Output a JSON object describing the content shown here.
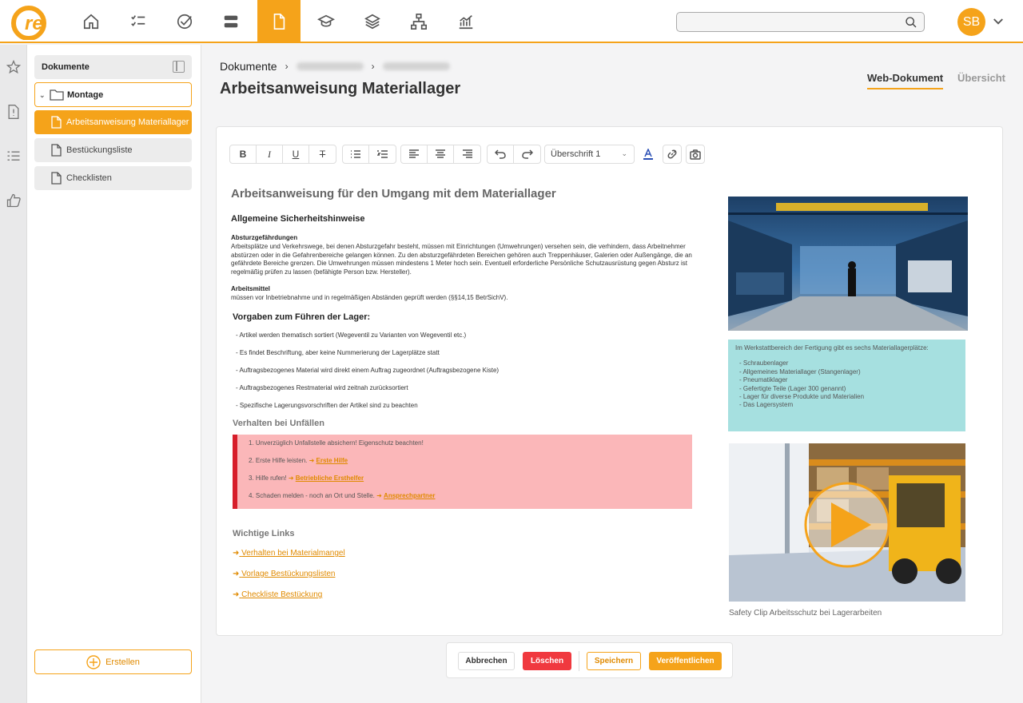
{
  "topbar": {
    "avatar_initials": "SB",
    "nav_icons": [
      "home-icon",
      "checklist-icon",
      "check-circle-icon",
      "stack-icon",
      "document-icon",
      "graduation-icon",
      "layers-icon",
      "hierarchy-icon",
      "chart-icon"
    ],
    "search_placeholder": ""
  },
  "rail": {
    "icons": [
      "star-icon",
      "warning-document-icon",
      "list-icon",
      "thumbs-up-icon"
    ]
  },
  "sidebar": {
    "header": "Dokumente",
    "folder": "Montage",
    "items": [
      {
        "label": "Arbeitsanweisung Materiallager",
        "active": true
      },
      {
        "label": "Bestückungsliste",
        "active": false
      },
      {
        "label": "Checklisten",
        "active": false
      }
    ],
    "create_label": "Erstellen"
  },
  "breadcrumb": {
    "root": "Dokumente"
  },
  "page": {
    "title": "Arbeitsanweisung Materiallager",
    "tabs": [
      {
        "label": "Web-Dokument",
        "active": true
      },
      {
        "label": "Übersicht",
        "active": false
      }
    ]
  },
  "toolbar": {
    "bold": "B",
    "italic": "I",
    "underline": "U",
    "strike": "T",
    "heading_select": "Überschrift 1"
  },
  "document": {
    "title": "Arbeitsanweisung für den Umgang mit dem Materiallager",
    "section1": "Allgemeine Sicherheitshinweise",
    "sub1_title": "Absturzgefährdungen",
    "sub1_text": "Arbeitsplätze und Verkehrswege, bei denen Absturzgefahr besteht, müssen mit Einrichtungen (Umwehrungen) versehen sein, die verhindern, dass Arbeitnehmer abstürzen oder in die Gefahrenbereiche gelangen können. Zu den absturzgefährdeten Bereichen gehören auch Treppenhäuser, Galerien oder Außengänge, die an gefährdete Bereiche grenzen. Die Umwehrungen müssen mindestens 1 Meter hoch sein. Eventuell erforderliche Persönliche Schutzausrüstung gegen Absturz ist regelmäßig prüfen zu lassen (befähigte Person bzw. Hersteller).",
    "sub2_title": "Arbeitsmittel",
    "sub2_text": "müssen vor Inbetriebnahme und in regelmäßigen Abständen geprüft werden (§§14,15 BetrSichV).",
    "section2": "Vorgaben zum Führen der Lager:",
    "vorgaben": [
      "- Artikel werden thematisch sortiert (Wegeventil zu Varianten von Wegeventil etc.)",
      "- Es findet Beschriftung, aber keine Nummerierung der Lagerplätze statt",
      "- Auftragsbezogenes Material wird direkt einem Auftrag zugeordnet (Auftragsbezogene Kiste)",
      "- Auftragsbezogenes Restmaterial wird zeitnah zurücksortiert",
      "- Spezifische Lagerungsvorschriften der Artikel sind zu beachten"
    ],
    "section3": "Verhalten bei Unfällen",
    "unfall_steps": [
      {
        "text": "1. Unverzüglich Unfallstelle absichern! Eigenschutz beachten!",
        "link": ""
      },
      {
        "text": "2. Erste Hilfe leisten. ",
        "link": "Erste Hilfe"
      },
      {
        "text": "3. Hilfe rufen! ",
        "link": "Betriebliche Ersthelfer"
      },
      {
        "text": "4. Schaden melden - noch an Ort und Stelle. ",
        "link": "Ansprechpartner"
      }
    ],
    "section4": "Wichtige Links",
    "links": [
      "Verhalten bei Materialmangel",
      "Vorlage Bestückungslisten",
      "Checkliste Bestückung"
    ],
    "infobox_intro": "Im Werkstattbereich der Fertigung gibt es sechs Materiallagerplätze:",
    "infobox_items": [
      "- Schraubenlager",
      "- Allgemeines Materiallager (Stangenlager)",
      "- Pneumatiklager",
      "- Gefertigte Teile (Lager 300 genannt)",
      "- Lager für diverse Produkte und Materialien",
      "- Das Lagersystem"
    ],
    "video_caption": "Safety Clip Arbeitsschutz bei Lagerarbeiten"
  },
  "actions": {
    "cancel": "Abbrechen",
    "delete": "Löschen",
    "save": "Speichern",
    "publish": "Veröffentlichen"
  },
  "colors": {
    "accent": "#f5a31a",
    "danger": "#f0393f",
    "alert_bg": "#fbb7b9",
    "alert_border": "#d71e2b",
    "info_bg": "#a6e0e0"
  }
}
